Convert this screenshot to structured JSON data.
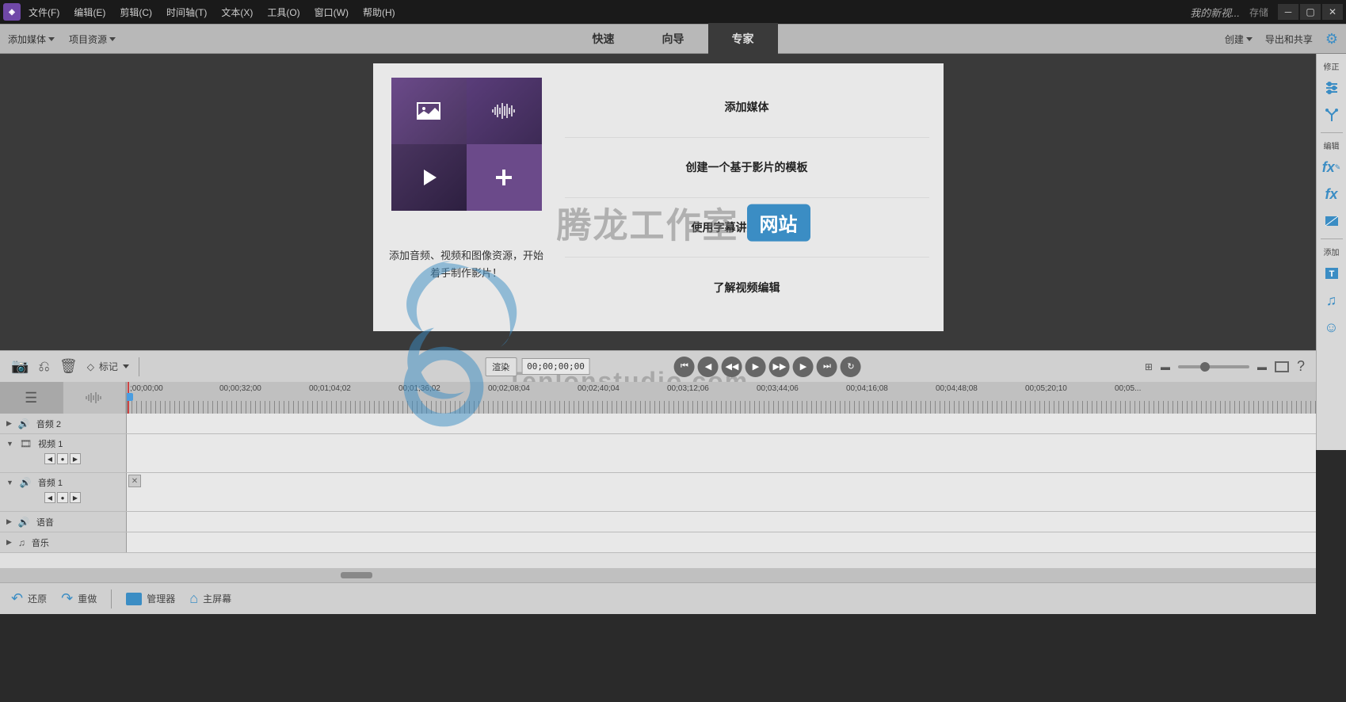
{
  "titlebar": {
    "menus": [
      "文件(F)",
      "编辑(E)",
      "剪辑(C)",
      "时间轴(T)",
      "文本(X)",
      "工具(O)",
      "窗口(W)",
      "帮助(H)"
    ],
    "project_name": "我的新视...",
    "save": "存储"
  },
  "toolbar": {
    "add_media": "添加媒体",
    "project_assets": "项目资源",
    "modes": [
      "快速",
      "向导",
      "专家"
    ],
    "active_mode": 2,
    "create": "创建",
    "export_share": "导出和共享"
  },
  "welcome": {
    "caption": "添加音频、视频和图像资源，开始着手制作影片！",
    "options": [
      "添加媒体",
      "创建一个基于影片的模板",
      "使用字幕讲述您的故事",
      "了解视频编辑"
    ]
  },
  "watermark": {
    "main": "腾龙工作室",
    "badge": "网站",
    "sub": "Tenlonstudio.com"
  },
  "ctrl": {
    "marker": "标记",
    "render": "渲染",
    "timecode": "00;00;00;00"
  },
  "ruler": {
    "marks": [
      ";00;00;00",
      "00;00;32;00",
      "00;01;04;02",
      "00;01;36;02",
      "00;02;08;04",
      "00;02;40;04",
      "00;03;12;06",
      "00;03;44;06",
      "00;04;16;08",
      "00;04;48;08",
      "00;05;20;10",
      "00;05..."
    ]
  },
  "tracks": {
    "items": [
      {
        "name": "音频 2",
        "type": "audio",
        "expanded": false
      },
      {
        "name": "视频 1",
        "type": "video",
        "expanded": true
      },
      {
        "name": "音频 1",
        "type": "audio",
        "expanded": true
      },
      {
        "name": "语音",
        "type": "voice",
        "expanded": false
      },
      {
        "name": "音乐",
        "type": "music",
        "expanded": false
      }
    ]
  },
  "bottom": {
    "undo": "还原",
    "redo": "重做",
    "organizer": "管理器",
    "home": "主屏幕"
  },
  "sidebar": {
    "section1": "修正",
    "section2": "编辑",
    "section3": "添加"
  }
}
